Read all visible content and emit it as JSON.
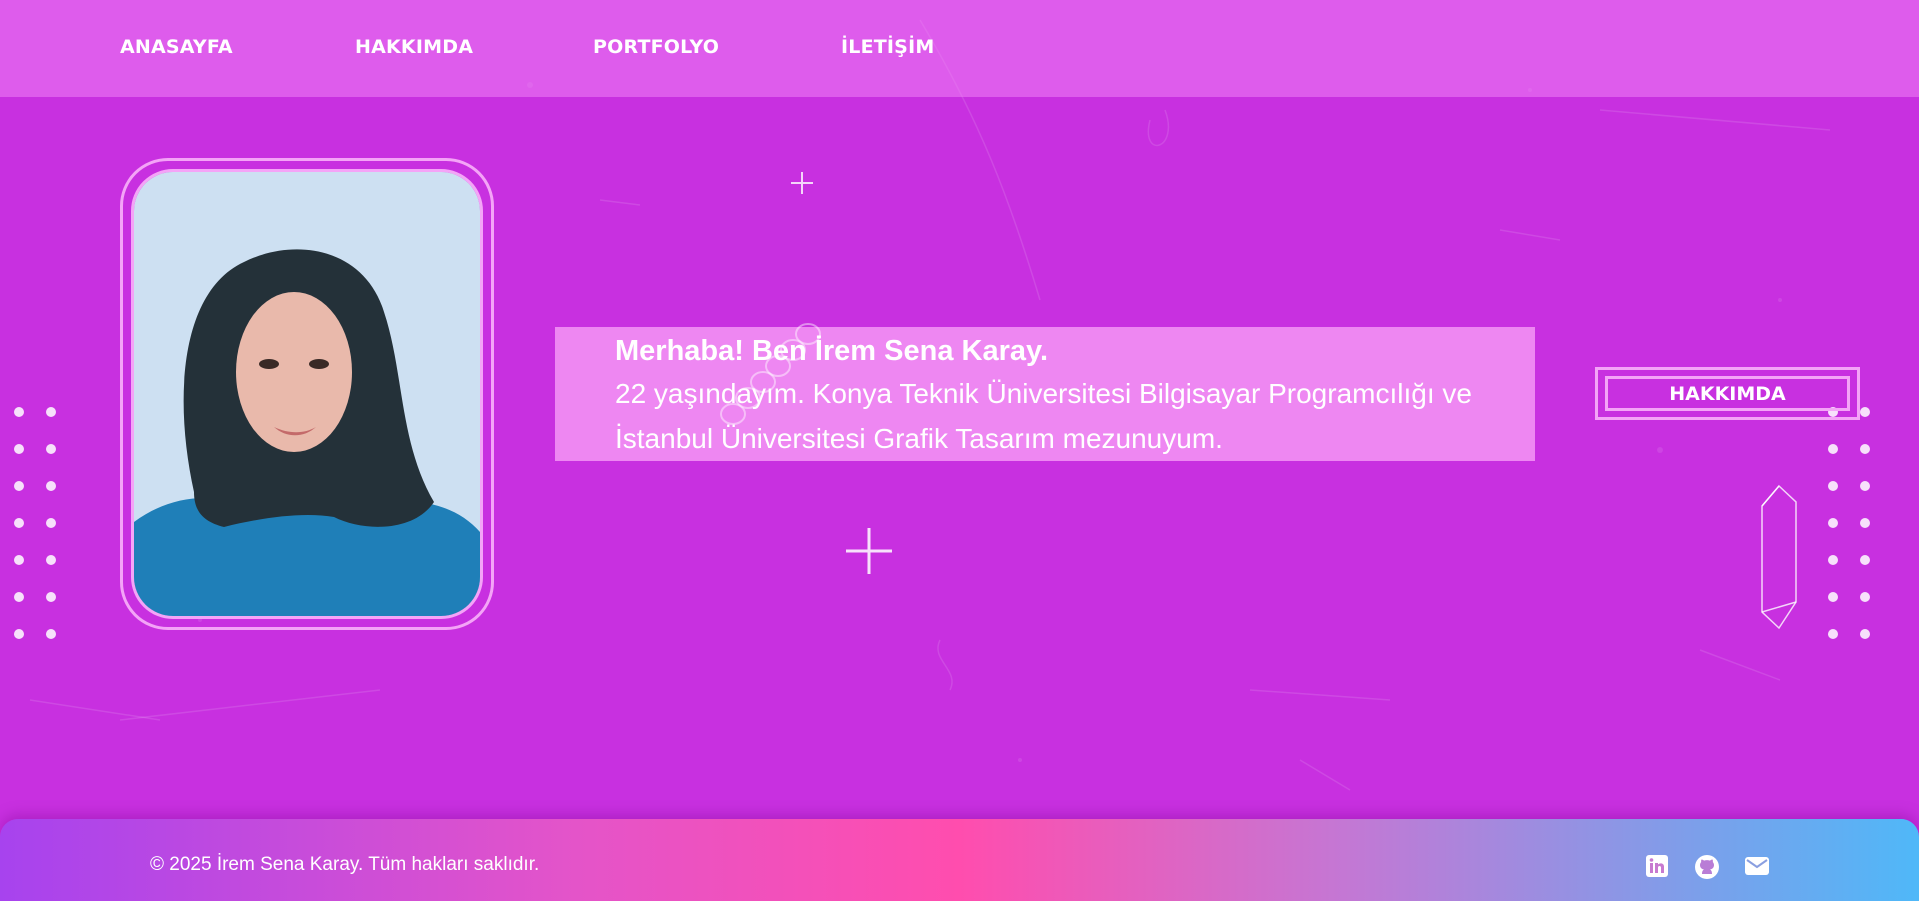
{
  "nav": {
    "items": [
      {
        "label": "ANASAYFA"
      },
      {
        "label": "HAKKIMDA"
      },
      {
        "label": "PORTFOLYO"
      },
      {
        "label": "İLETİŞİM"
      }
    ]
  },
  "intro": {
    "title": "Merhaba! Ben İrem Sena Karay.",
    "line1": "22 yaşındayım. Konya Teknik Üniversitesi Bilgisayar Programcılığı ve",
    "line2": "İstanbul Üniversitesi Grafik Tasarım mezunuyum."
  },
  "about_button": {
    "label": "HAKKIMDA"
  },
  "footer": {
    "copyright": "© 2025 İrem Sena Karay. Tüm hakları saklıdır.",
    "social": [
      {
        "icon": "linkedin-icon"
      },
      {
        "icon": "github-icon"
      },
      {
        "icon": "envelope-icon"
      }
    ]
  },
  "colors": {
    "background": "#c830e0",
    "navbar": "#e76cf0",
    "accent_border": "#f4a4f7",
    "intro_box": "#f79bf5",
    "footer_start": "#a743ee",
    "footer_mid": "#ff4dae",
    "footer_end": "#4fb8f8"
  }
}
